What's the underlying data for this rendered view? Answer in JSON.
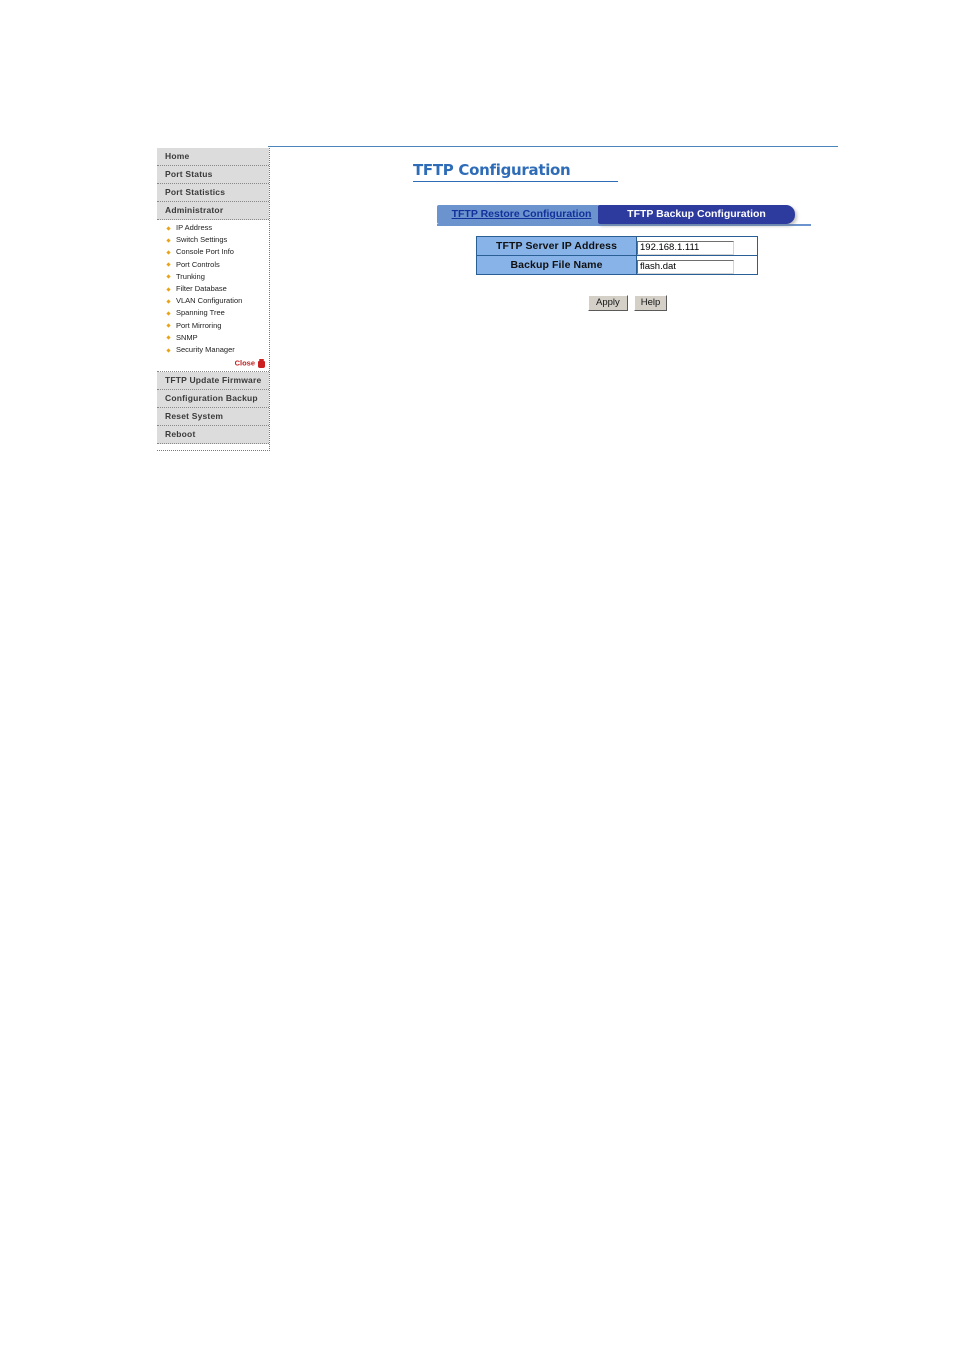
{
  "sidebar": {
    "top_items": [
      {
        "label": "Home",
        "name": "home"
      },
      {
        "label": "Port Status",
        "name": "port-status"
      },
      {
        "label": "Port Statistics",
        "name": "port-statistics"
      },
      {
        "label": "Administrator",
        "name": "administrator"
      }
    ],
    "sub_items": [
      {
        "label": "IP Address",
        "name": "ip-address"
      },
      {
        "label": "Switch Settings",
        "name": "switch-settings"
      },
      {
        "label": "Console Port Info",
        "name": "console-port-info"
      },
      {
        "label": "Port Controls",
        "name": "port-controls"
      },
      {
        "label": "Trunking",
        "name": "trunking"
      },
      {
        "label": "Filter Database",
        "name": "filter-database"
      },
      {
        "label": "VLAN Configuration",
        "name": "vlan-configuration"
      },
      {
        "label": "Spanning Tree",
        "name": "spanning-tree"
      },
      {
        "label": "Port Mirroring",
        "name": "port-mirroring"
      },
      {
        "label": "SNMP",
        "name": "snmp"
      },
      {
        "label": "Security Manager",
        "name": "security-manager"
      }
    ],
    "close_label": "Close",
    "close_icon": "trash-icon",
    "bottom_items": [
      {
        "label": "TFTP Update Firmware",
        "name": "tftp-update-firmware"
      },
      {
        "label": "Configuration Backup",
        "name": "configuration-backup"
      },
      {
        "label": "Reset System",
        "name": "reset-system"
      },
      {
        "label": "Reboot",
        "name": "reboot"
      }
    ]
  },
  "main": {
    "page_title": "TFTP Configuration",
    "tabs": [
      {
        "label": "TFTP Restore Configuration",
        "active": false
      },
      {
        "label": "TFTP Backup Configuration",
        "active": true
      }
    ],
    "fields": [
      {
        "label": "TFTP Server IP Address",
        "value": "192.168.1.111"
      },
      {
        "label": "Backup File Name",
        "value": "flash.dat"
      }
    ],
    "buttons": [
      {
        "label": "Apply",
        "name": "apply-button"
      },
      {
        "label": "Help",
        "name": "help-button"
      }
    ]
  },
  "colors": {
    "title_blue": "#2e6cb8",
    "tab_active_bg": "#2d3a9e",
    "tab_inactive_bg": "#6b94cf",
    "field_label_bg": "#88b3e8",
    "table_border": "#2a5f96",
    "bullet_gold": "#e8a416",
    "close_red": "#cc1f1f",
    "nav_top_bg": "#dcdcdc",
    "top_rule": "#4a86b8"
  }
}
